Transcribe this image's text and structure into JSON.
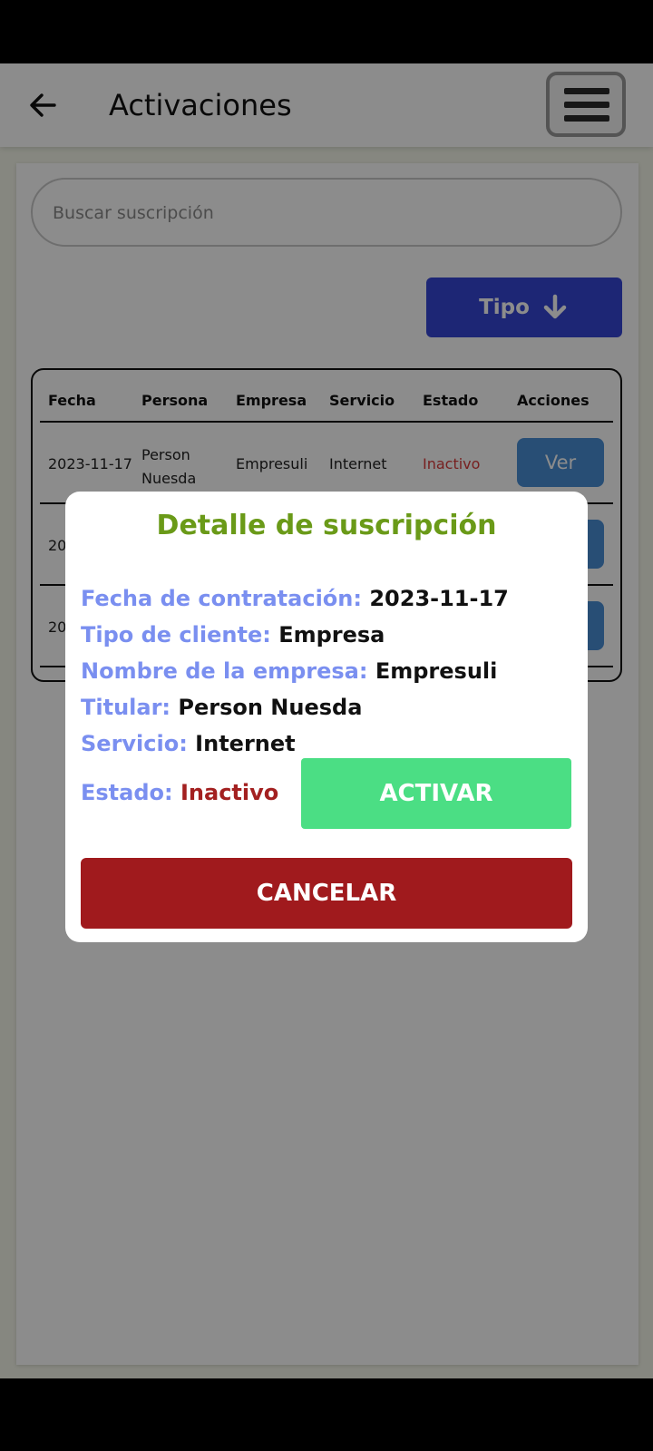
{
  "header": {
    "title": "Activaciones",
    "back_icon": "arrow-left-icon",
    "menu_icon": "hamburger-menu-icon"
  },
  "search": {
    "placeholder": "Buscar suscripción",
    "value": ""
  },
  "filter": {
    "tipo_label": "Tipo",
    "tipo_icon": "arrow-down-icon"
  },
  "table": {
    "columns": [
      "Fecha",
      "Persona",
      "Empresa",
      "Servicio",
      "Estado",
      "Acciones"
    ],
    "rows": [
      {
        "fecha": "2023-11-17",
        "persona_line1": "Person",
        "persona_line2": "Nuesda",
        "empresa": "Empresuli",
        "servicio": "Internet",
        "estado": "Inactivo",
        "accion": "Ver"
      },
      {
        "fecha": "20"
      },
      {
        "fecha": "20"
      }
    ]
  },
  "modal": {
    "title": "Detalle de suscripción",
    "fecha_label": "Fecha de contratación:",
    "fecha_value": "2023-11-17",
    "tipo_label": "Tipo de cliente:",
    "tipo_value": "Empresa",
    "empresa_label": "Nombre de la empresa:",
    "empresa_value": "Empresuli",
    "titular_label": "Titular:",
    "titular_value": "Person Nuesda",
    "servicio_label": "Servicio:",
    "servicio_value": "Internet",
    "estado_label": "Estado:",
    "estado_value": "Inactivo",
    "activar_label": "ACTIVAR",
    "cancelar_label": "CANCELAR"
  },
  "colors": {
    "accent_blue": "#3646d6",
    "ver_button": "#4a8fd6",
    "modal_title": "#6a9a18",
    "label_color": "#7a8ff0",
    "inactive": "#a32020",
    "activar": "#4bde84",
    "cancelar": "#a01a1d"
  }
}
